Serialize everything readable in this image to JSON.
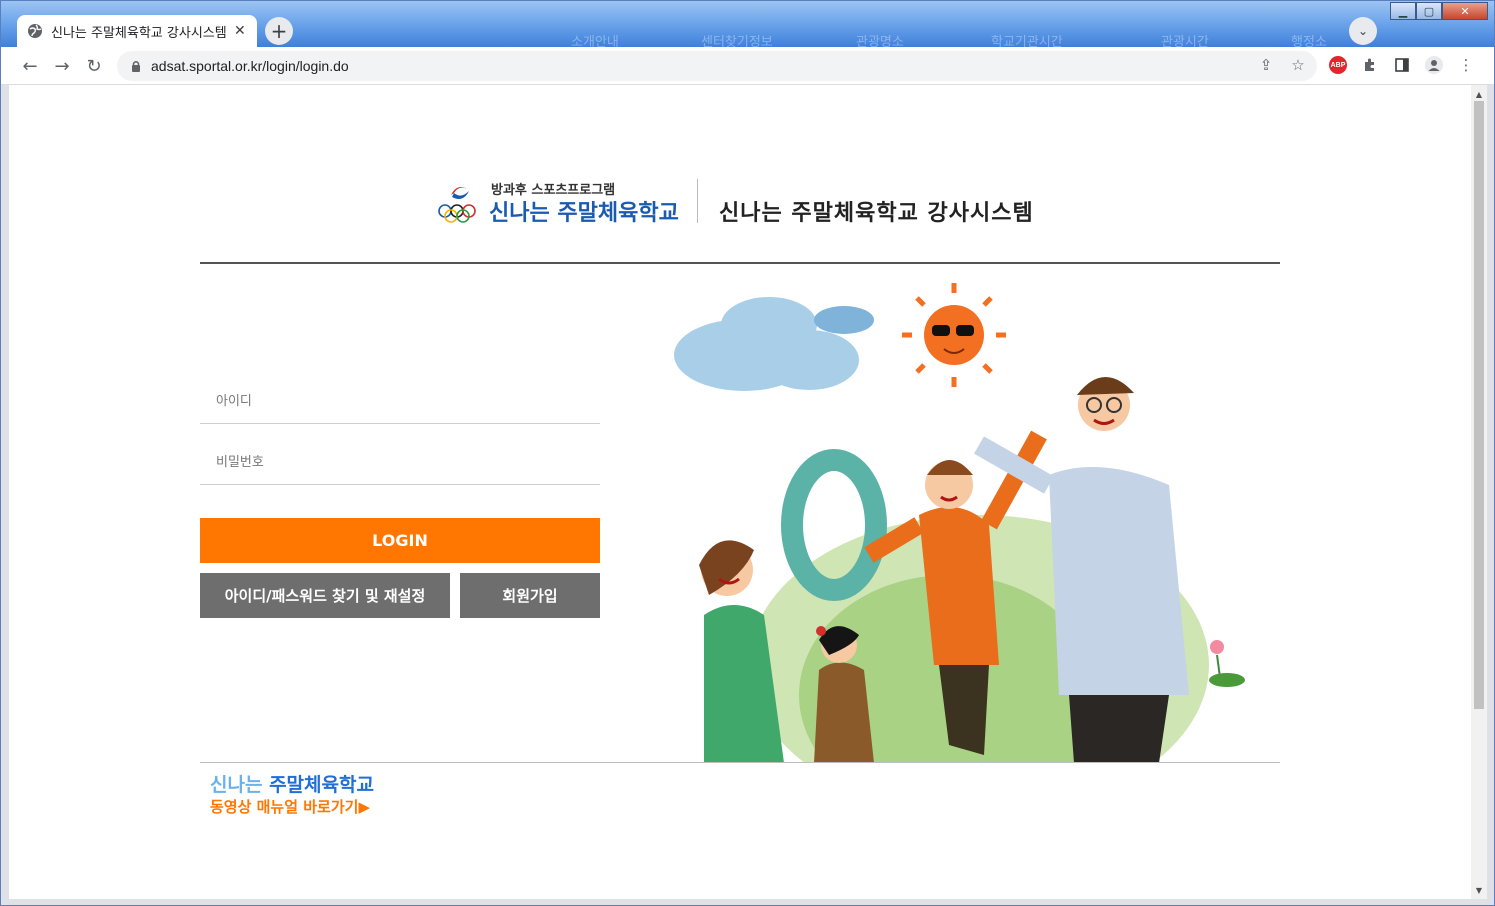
{
  "browser": {
    "tab": {
      "title": "신나는 주말체육학교 강사시스템"
    },
    "address": {
      "url": "adsat.sportal.or.kr/login/login.do"
    },
    "background_words": [
      "소개안내",
      "센터찾기정보",
      "관광명소",
      "학교기관시간",
      "관광시간",
      "행정소"
    ],
    "extensions": {
      "abp_label": "ABP"
    }
  },
  "header": {
    "logo_subtitle": "방과후 스포츠프로그램",
    "logo_title": "신나는 주말체육학교",
    "system_title": "신나는 주말체육학교 강사시스템"
  },
  "login_form": {
    "id_placeholder": "아이디",
    "password_placeholder": "비밀번호",
    "login_label": "LOGIN",
    "find_label": "아이디/패스워드 찾기 및 재설정",
    "signup_label": "회원가입"
  },
  "manual": {
    "brand_part1": "신나는 ",
    "brand_part2": "주말체육학교",
    "link_label": "동영상 매뉴얼 바로가기▶"
  },
  "colors": {
    "accent": "#ff7700",
    "secondary_button": "#6e6e6e",
    "brand_blue": "#1f6fd6"
  }
}
